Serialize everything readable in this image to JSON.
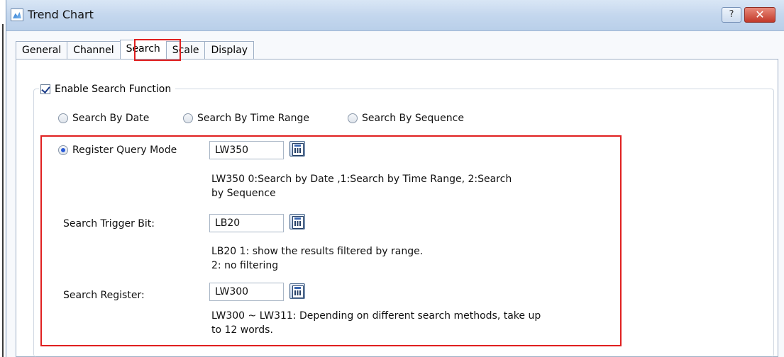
{
  "window": {
    "title": "Trend Chart",
    "help_label": "?",
    "close_label": "✕"
  },
  "tabs": [
    {
      "label": "General",
      "active": false
    },
    {
      "label": "Channel",
      "active": false
    },
    {
      "label": "Search",
      "active": true
    },
    {
      "label": "Scale",
      "active": false
    },
    {
      "label": "Display",
      "active": false
    }
  ],
  "search": {
    "enable_label": "Enable Search Function",
    "enable_checked": true,
    "modes": [
      {
        "label": "Search By Date",
        "selected": false
      },
      {
        "label": "Search By Time Range",
        "selected": false
      },
      {
        "label": "Search By Sequence",
        "selected": false
      }
    ],
    "register_query": {
      "label": "Register Query Mode",
      "selected": true,
      "value": "LW350",
      "desc_line1": "LW350 0:Search by Date ,1:Search by Time Range, 2:Search",
      "desc_line2": "by Sequence"
    },
    "trigger_bit": {
      "label": "Search Trigger Bit:",
      "value": "LB20",
      "desc_line1": "LB20 1: show the results filtered by range.",
      "desc_line2": "2: no filtering"
    },
    "search_register": {
      "label": "Search Register:",
      "value": "LW300",
      "desc_line1": "LW300 ~ LW311: Depending on different search methods, take up",
      "desc_line2": "to 12 words."
    }
  },
  "colors": {
    "highlight": "#e02020",
    "radio_selected": "#2a5bd7"
  }
}
